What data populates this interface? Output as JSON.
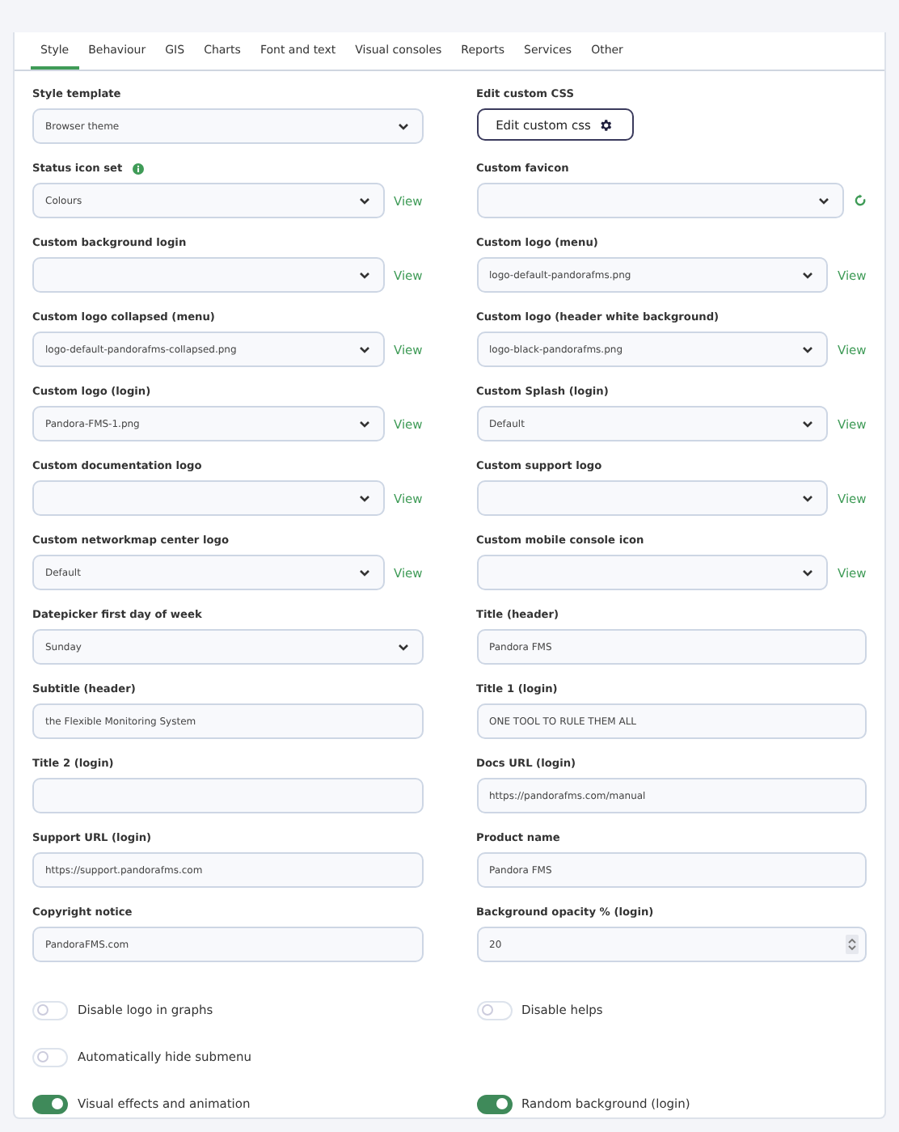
{
  "tabs": [
    {
      "label": "Style",
      "selected": true
    },
    {
      "label": "Behaviour",
      "selected": false
    },
    {
      "label": "GIS",
      "selected": false
    },
    {
      "label": "Charts",
      "selected": false
    },
    {
      "label": "Font and text",
      "selected": false
    },
    {
      "label": "Visual consoles",
      "selected": false
    },
    {
      "label": "Reports",
      "selected": false
    },
    {
      "label": "Services",
      "selected": false
    },
    {
      "label": "Other",
      "selected": false
    }
  ],
  "rows": [
    {
      "left": {
        "kind": "select",
        "label": "Style template",
        "value": "Browser theme"
      },
      "right": {
        "kind": "button",
        "label": "Edit custom CSS",
        "button": "Edit custom css"
      }
    },
    {
      "left": {
        "kind": "select",
        "label": "Status icon set",
        "value": "Colours",
        "info": true,
        "link": "View"
      },
      "right": {
        "kind": "select",
        "label": "Custom favicon",
        "refresh": true
      }
    },
    {
      "left": {
        "kind": "select",
        "label": "Custom background login",
        "link": "View"
      },
      "right": {
        "kind": "select",
        "label": "Custom logo (menu)",
        "value": "logo-default-pandorafms.png",
        "link": "View"
      }
    },
    {
      "left": {
        "kind": "select",
        "label": "Custom logo collapsed (menu)",
        "value": "logo-default-pandorafms-collapsed.png",
        "link": "View"
      },
      "right": {
        "kind": "select",
        "label": "Custom logo (header white background)",
        "value": "logo-black-pandorafms.png",
        "link": "View"
      }
    },
    {
      "left": {
        "kind": "select",
        "label": "Custom logo (login)",
        "value": "Pandora-FMS-1.png",
        "link": "View"
      },
      "right": {
        "kind": "select",
        "label": "Custom Splash (login)",
        "value": "Default",
        "link": "View"
      }
    },
    {
      "left": {
        "kind": "select",
        "label": "Custom documentation logo",
        "link": "View"
      },
      "right": {
        "kind": "select",
        "label": "Custom support logo",
        "link": "View"
      }
    },
    {
      "left": {
        "kind": "select",
        "label": "Custom networkmap center logo",
        "value": "Default",
        "link": "View"
      },
      "right": {
        "kind": "select",
        "label": "Custom mobile console icon",
        "link": "View"
      }
    },
    {
      "left": {
        "kind": "select",
        "label": "Datepicker first day of week",
        "value": "Sunday"
      },
      "right": {
        "kind": "text",
        "label": "Title (header)",
        "value": "Pandora FMS"
      }
    },
    {
      "left": {
        "kind": "text",
        "label": "Subtitle (header)",
        "value": "the Flexible Monitoring System"
      },
      "right": {
        "kind": "text",
        "label": "Title 1 (login)",
        "value": "ONE TOOL TO RULE THEM ALL"
      }
    },
    {
      "left": {
        "kind": "text",
        "label": "Title 2 (login)"
      },
      "right": {
        "kind": "text",
        "label": "Docs URL (login)",
        "value": "https://pandorafms.com/manual"
      }
    },
    {
      "left": {
        "kind": "text",
        "label": "Support URL (login)",
        "value": "https://support.pandorafms.com"
      },
      "right": {
        "kind": "text",
        "label": "Product name",
        "value": "Pandora FMS"
      }
    },
    {
      "left": {
        "kind": "text",
        "label": "Copyright notice",
        "value": "PandoraFMS.com"
      },
      "right": {
        "kind": "number",
        "label": "Background opacity % (login)",
        "value": "20"
      }
    }
  ],
  "toggle_rows": [
    {
      "left": {
        "label": "Disable logo in graphs",
        "on": false
      },
      "right": {
        "label": "Disable helps",
        "on": false
      }
    },
    {
      "left": {
        "label": "Automatically hide submenu",
        "on": false
      }
    },
    {
      "left": {
        "label": "Visual effects and animation",
        "on": true
      },
      "right": {
        "label": "Random background (login)",
        "on": true
      }
    }
  ]
}
